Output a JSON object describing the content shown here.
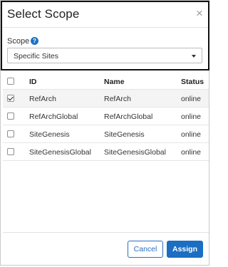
{
  "dialog": {
    "title": "Select Scope",
    "close_symbol": "×"
  },
  "scope": {
    "label": "Scope",
    "help_symbol": "?",
    "selected": "Specific Sites"
  },
  "table": {
    "headers": {
      "id": "ID",
      "name": "Name",
      "status": "Status"
    },
    "rows": [
      {
        "id": "RefArch",
        "name": "RefArch",
        "status": "online",
        "checked": true
      },
      {
        "id": "RefArchGlobal",
        "name": "RefArchGlobal",
        "status": "online",
        "checked": false
      },
      {
        "id": "SiteGenesis",
        "name": "SiteGenesis",
        "status": "online",
        "checked": false
      },
      {
        "id": "SiteGenesisGlobal",
        "name": "SiteGenesisGlobal",
        "status": "online",
        "checked": false
      }
    ]
  },
  "footer": {
    "cancel_label": "Cancel",
    "assign_label": "Assign"
  },
  "colors": {
    "accent": "#1b6ec2",
    "highlight_border": "#111111"
  }
}
